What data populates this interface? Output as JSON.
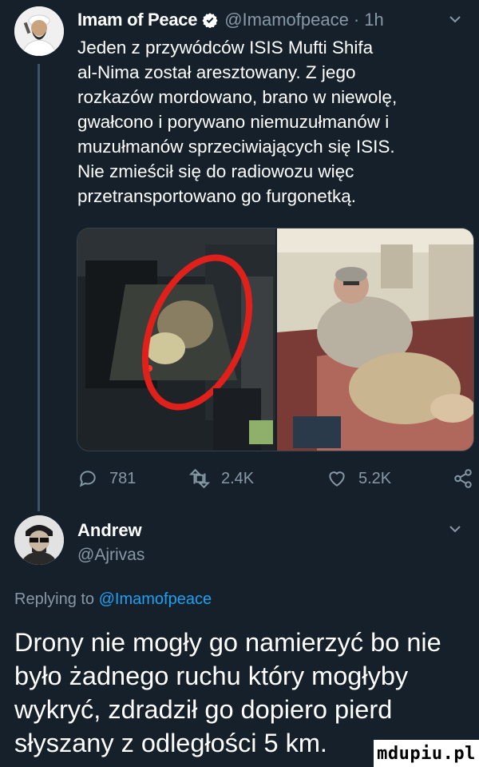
{
  "tweet": {
    "author_name": "Imam of Peace",
    "handle": "@Imamofpeace",
    "time": "· 1h",
    "text_lines": [
      "Jeden z przywódców ISIS Mufti Shifa",
      "al-Nima został aresztowany. Z jego",
      "rozkazów mordowano, brano w niewolę,",
      "gwałcono i porywano niemuzułmanów i",
      "muzułmanów sprzeciwiających się ISIS.",
      "Nie zmieścił się do radiowozu więc",
      "przetransportowano go furgonetką."
    ],
    "stats": {
      "replies": "781",
      "retweets": "2.4K",
      "likes": "5.2K"
    }
  },
  "reply": {
    "author_name": "Andrew",
    "handle": "@Ajrivas",
    "replying_prefix": "Replying to",
    "replying_handle": "@Imamofpeace",
    "text_lines": [
      "Drony nie mogły go namierzyć bo nie",
      "było żadnego ruchu który mogłyby",
      "wykryć, zdradził go dopiero pierd",
      "słyszany z odległości 5 km."
    ]
  },
  "watermark": "mdupiu.pl",
  "colors": {
    "background": "#15202b",
    "muted": "#8899a6",
    "accent": "#1da1f2"
  }
}
